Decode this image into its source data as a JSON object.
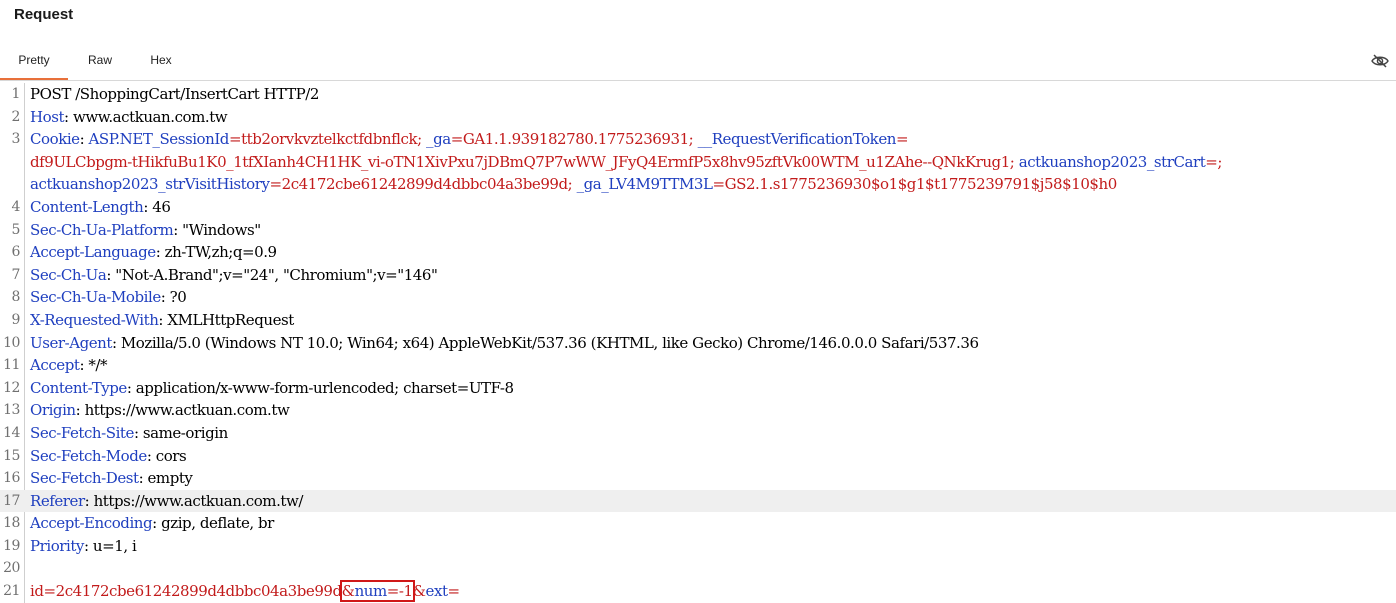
{
  "panel": {
    "title": "Request"
  },
  "tabs": [
    {
      "label": "Pretty",
      "active": true
    },
    {
      "label": "Raw",
      "active": false
    },
    {
      "label": "Hex",
      "active": false
    }
  ],
  "toolbar": {
    "hide_icon": "eye-slash-icon"
  },
  "colors": {
    "header_name": "#1f3fbf",
    "cookie_value": "#c21b1b",
    "active_tab": "#e8703a",
    "highlight_box": "#d01818"
  },
  "request": {
    "request_line": "POST /ShoppingCart/InsertCart HTTP/2",
    "headers": [
      {
        "n": "1",
        "name": "",
        "value": "POST /ShoppingCart/InsertCart HTTP/2"
      },
      {
        "n": "2",
        "name": "Host",
        "value": " www.actkuan.com.tw"
      },
      {
        "n": "4",
        "name": "Content-Length",
        "value": " 46"
      },
      {
        "n": "5",
        "name": "Sec-Ch-Ua-Platform",
        "value": " \"Windows\""
      },
      {
        "n": "6",
        "name": "Accept-Language",
        "value": " zh-TW,zh;q=0.9"
      },
      {
        "n": "7",
        "name": "Sec-Ch-Ua",
        "value": " \"Not-A.Brand\";v=\"24\", \"Chromium\";v=\"146\""
      },
      {
        "n": "8",
        "name": "Sec-Ch-Ua-Mobile",
        "value": " ?0"
      },
      {
        "n": "9",
        "name": "X-Requested-With",
        "value": " XMLHttpRequest"
      },
      {
        "n": "10",
        "name": "User-Agent",
        "value": " Mozilla/5.0 (Windows NT 10.0; Win64; x64) AppleWebKit/537.36 (KHTML, like Gecko) Chrome/146.0.0.0 Safari/537.36"
      },
      {
        "n": "11",
        "name": "Accept",
        "value": " */*"
      },
      {
        "n": "12",
        "name": "Content-Type",
        "value": " application/x-www-form-urlencoded; charset=UTF-8"
      },
      {
        "n": "13",
        "name": "Origin",
        "value": " https://www.actkuan.com.tw"
      },
      {
        "n": "14",
        "name": "Sec-Fetch-Site",
        "value": " same-origin"
      },
      {
        "n": "15",
        "name": "Sec-Fetch-Mode",
        "value": " cors"
      },
      {
        "n": "16",
        "name": "Sec-Fetch-Dest",
        "value": " empty"
      },
      {
        "n": "17",
        "name": "Referer",
        "value": " https://www.actkuan.com.tw/"
      },
      {
        "n": "18",
        "name": "Accept-Encoding",
        "value": " gzip, deflate, br"
      },
      {
        "n": "19",
        "name": "Priority",
        "value": " u=1, i"
      }
    ],
    "cookie": {
      "n": "3",
      "name": "Cookie",
      "sep": ": ",
      "lines": [
        [
          {
            "t": "ck",
            "s": "ASP.NET_SessionId"
          },
          {
            "t": "cv",
            "s": "=ttb2orvkvztelkctfdbnflck; "
          },
          {
            "t": "ck",
            "s": "_ga"
          },
          {
            "t": "cv",
            "s": "=GA1.1.939182780.1775236931; "
          },
          {
            "t": "ck",
            "s": "__RequestVerificationToken"
          },
          {
            "t": "cv",
            "s": "="
          }
        ],
        [
          {
            "t": "cv",
            "s": "df9ULCbpgm-tHikfuBu1K0_1tfXIanh4CH1HK_vi-oTN1XivPxu7jDBmQ7P7wWW_JFyQ4ErmfP5x8hv95zftVk00WTM_u1ZAhe--QNkKrug1; "
          },
          {
            "t": "ck",
            "s": "actkuanshop2023_strCart"
          },
          {
            "t": "cv",
            "s": "=;"
          }
        ],
        [
          {
            "t": "ck",
            "s": "actkuanshop2023_strVisitHistory"
          },
          {
            "t": "cv",
            "s": "=2c4172cbe61242899d4dbbc04a3be99d; "
          },
          {
            "t": "ck",
            "s": "_ga_LV4M9TTM3L"
          },
          {
            "t": "cv",
            "s": "=GS2.1.s1775236930$o1$g1$t1775239791$j58$10$h0"
          }
        ]
      ]
    },
    "empty_line_n": "20",
    "body": {
      "n": "21",
      "parts": [
        {
          "t": "bk",
          "s": "id"
        },
        {
          "t": "bk",
          "s": "=2c4172cbe61242899d4dbbc04a3be99d"
        },
        {
          "t": "bk",
          "s": "&",
          "box": true
        },
        {
          "t": "bv",
          "s": "num",
          "box": true
        },
        {
          "t": "bk",
          "s": "=-1",
          "box": true
        },
        {
          "t": "bk",
          "s": "&"
        },
        {
          "t": "bv",
          "s": "ext"
        },
        {
          "t": "bk",
          "s": "="
        }
      ]
    }
  }
}
